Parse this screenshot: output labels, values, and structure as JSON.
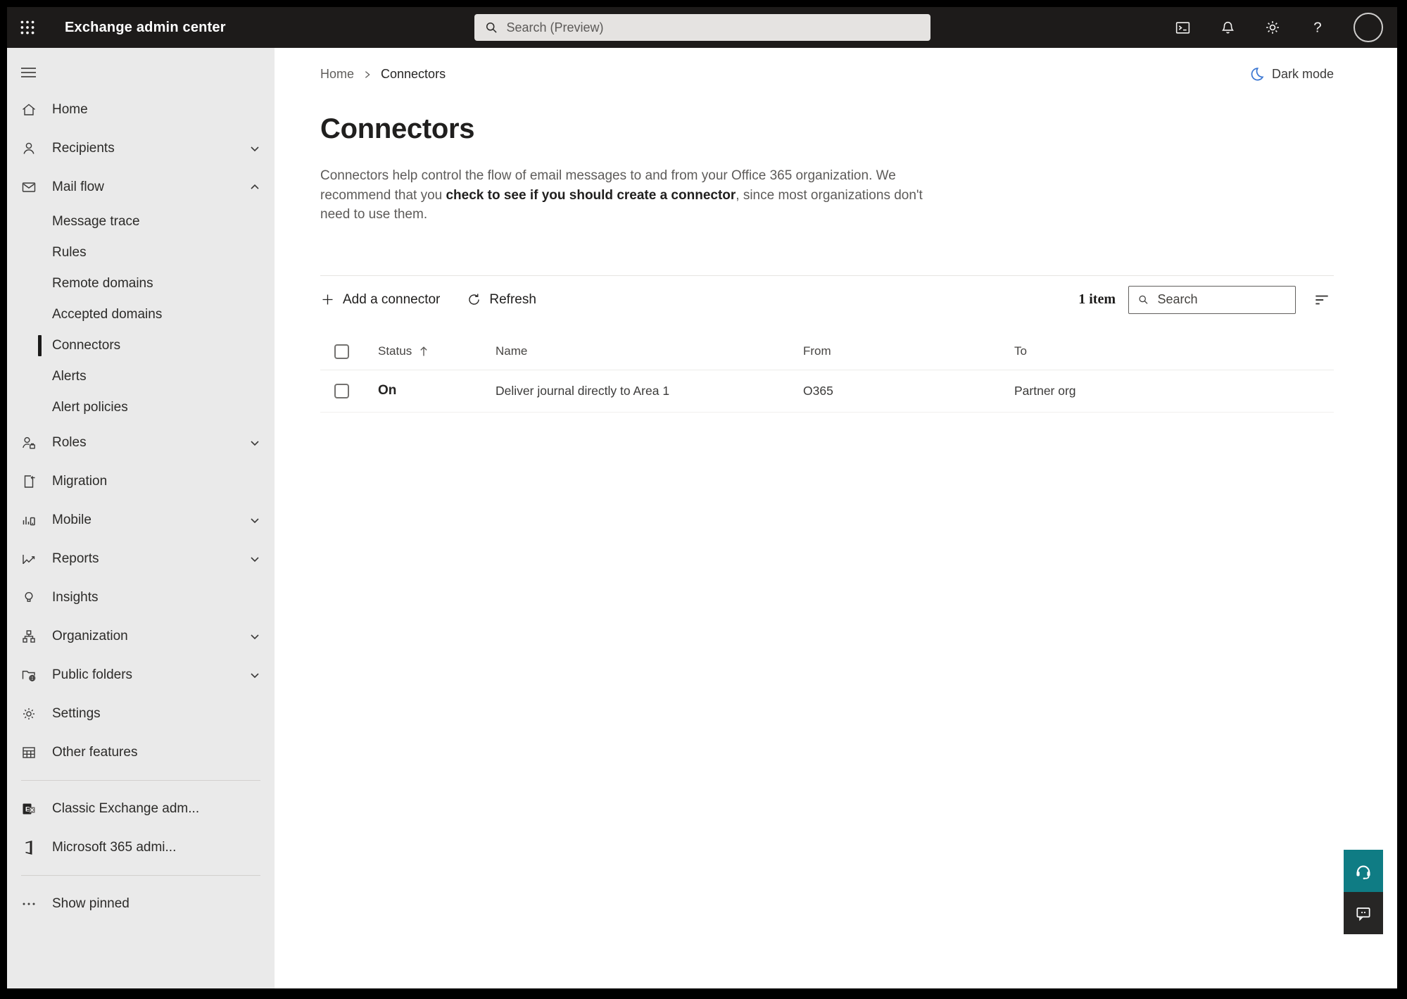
{
  "topbar": {
    "app_title": "Exchange admin center",
    "search_placeholder": "Search (Preview)"
  },
  "header": {
    "breadcrumb": {
      "home": "Home",
      "current": "Connectors"
    },
    "dark_mode_label": "Dark mode"
  },
  "page": {
    "title": "Connectors",
    "description": {
      "part1": "Connectors help control the flow of email messages to and from your Office 365 organization. We recommend that you ",
      "emphasis": "check to see if you should create a connector",
      "part2": ", since most organizations don't need to use them."
    }
  },
  "toolbar": {
    "add_label": "Add a connector",
    "refresh_label": "Refresh",
    "item_count": "1 item",
    "search_placeholder": "Search"
  },
  "table": {
    "columns": {
      "status": "Status",
      "name": "Name",
      "from": "From",
      "to": "To"
    },
    "sort": {
      "column": "Status",
      "direction": "ascending"
    },
    "rows": [
      {
        "status": "On",
        "name": "Deliver journal directly to Area 1",
        "from": "O365",
        "to": "Partner org"
      }
    ]
  },
  "sidebar": {
    "items": [
      {
        "label": "Home"
      },
      {
        "label": "Recipients",
        "expandable": true
      },
      {
        "label": "Mail flow",
        "expandable": true,
        "expanded": true
      },
      {
        "label": "Message trace",
        "sub": true
      },
      {
        "label": "Rules",
        "sub": true
      },
      {
        "label": "Remote domains",
        "sub": true
      },
      {
        "label": "Accepted domains",
        "sub": true
      },
      {
        "label": "Connectors",
        "sub": true,
        "selected": true
      },
      {
        "label": "Alerts",
        "sub": true
      },
      {
        "label": "Alert policies",
        "sub": true
      },
      {
        "label": "Roles",
        "expandable": true
      },
      {
        "label": "Migration"
      },
      {
        "label": "Mobile",
        "expandable": true
      },
      {
        "label": "Reports",
        "expandable": true
      },
      {
        "label": "Insights"
      },
      {
        "label": "Organization",
        "expandable": true
      },
      {
        "label": "Public folders",
        "expandable": true
      },
      {
        "label": "Settings"
      },
      {
        "label": "Other features"
      },
      {
        "label": "Classic Exchange adm..."
      },
      {
        "label": "Microsoft 365 admi..."
      },
      {
        "label": "Show pinned"
      }
    ]
  },
  "colors": {
    "topbar_bg": "#1d1b1a",
    "sidebar_bg": "#eaeaea",
    "dark_mode_moon_blue": "#3a76d2",
    "help_button_teal": "#0f7c84",
    "feedback_button_dark": "#272625"
  }
}
